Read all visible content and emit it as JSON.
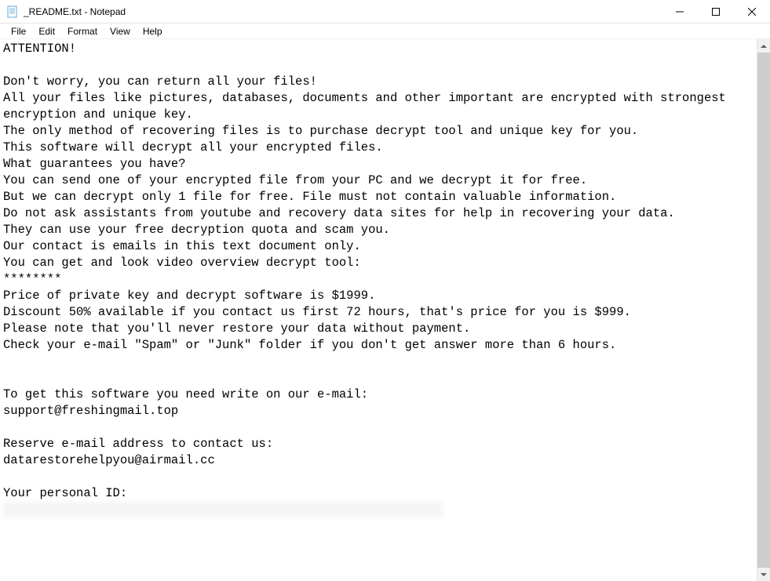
{
  "window": {
    "title": "_README.txt - Notepad"
  },
  "menu": {
    "file": "File",
    "edit": "Edit",
    "format": "Format",
    "view": "View",
    "help": "Help"
  },
  "content": {
    "line1": "ATTENTION!",
    "line2": "",
    "line3": "Don't worry, you can return all your files!",
    "line4": "All your files like pictures, databases, documents and other important are encrypted with strongest encryption and unique key.",
    "line5": "The only method of recovering files is to purchase decrypt tool and unique key for you.",
    "line6": "This software will decrypt all your encrypted files.",
    "line7": "What guarantees you have?",
    "line8": "You can send one of your encrypted file from your PC and we decrypt it for free.",
    "line9": "But we can decrypt only 1 file for free. File must not contain valuable information.",
    "line10": "Do not ask assistants from youtube and recovery data sites for help in recovering your data.",
    "line11": "They can use your free decryption quota and scam you.",
    "line12": "Our contact is emails in this text document only.",
    "line13": "You can get and look video overview decrypt tool:",
    "line14": "********",
    "line15": "Price of private key and decrypt software is $1999.",
    "line16": "Discount 50% available if you contact us first 72 hours, that's price for you is $999.",
    "line17": "Please note that you'll never restore your data without payment.",
    "line18": "Check your e-mail \"Spam\" or \"Junk\" folder if you don't get answer more than 6 hours.",
    "line19": "",
    "line20": "",
    "line21": "To get this software you need write on our e-mail:",
    "line22": "support@freshingmail.top",
    "line23": "",
    "line24": "Reserve e-mail address to contact us:",
    "line25": "datarestorehelpyou@airmail.cc",
    "line26": "",
    "line27": "Your personal ID:"
  }
}
